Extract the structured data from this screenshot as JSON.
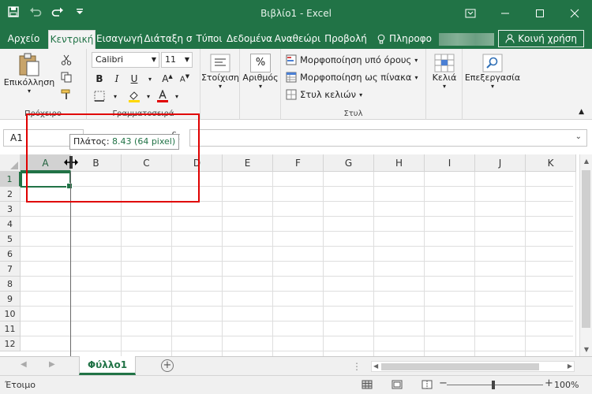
{
  "window": {
    "title": "Βιβλίο1 - Excel",
    "accent": "#217346"
  },
  "quick_access": [
    "save-icon",
    "undo-icon",
    "redo-icon",
    "customize-icon"
  ],
  "tabs": [
    {
      "label": "Αρχείο"
    },
    {
      "label": "Κεντρική"
    },
    {
      "label": "Εισαγωγή"
    },
    {
      "label": "Διάταξη σ"
    },
    {
      "label": "Τύποι"
    },
    {
      "label": "Δεδομένα"
    },
    {
      "label": "Αναθεώρι"
    },
    {
      "label": "Προβολή"
    },
    {
      "label": "Πληροφο"
    }
  ],
  "share_label": "Κοινή χρήση",
  "ribbon": {
    "paste_label": "Επικόλληση",
    "clipboard_label": "Πρόχειρο",
    "font_name": "Calibri",
    "font_size": "11",
    "font_group_label": "Γραμματοσειρά",
    "alignment_label": "Στοίχιση",
    "number_label": "Αριθμός",
    "number_symbol": "%",
    "conditional_format": "Μορφοποίηση υπό όρους",
    "format_table": "Μορφοποίηση ως πίνακα",
    "cell_styles": "Στυλ κελιών",
    "styles_group_label": "Στυλ",
    "cells_label": "Κελιά",
    "editing_label": "Επεξεργασία"
  },
  "formula_bar": {
    "name_box": "A1",
    "fx": "fx",
    "value": ""
  },
  "tooltip": {
    "prefix": "Πλάτος: ",
    "value": "8.43 (64 pixel)"
  },
  "columns": [
    "A",
    "B",
    "C",
    "D",
    "E",
    "F",
    "G",
    "H",
    "I",
    "J",
    "K"
  ],
  "rows": [
    "1",
    "2",
    "3",
    "4",
    "5",
    "6",
    "7",
    "8",
    "9",
    "10",
    "11",
    "12"
  ],
  "selected_cell": {
    "column": "A",
    "row": "1"
  },
  "sheets": [
    {
      "label": "Φύλλο1",
      "active": true
    }
  ],
  "status": {
    "ready": "Έτοιμο",
    "zoom": "100%"
  }
}
